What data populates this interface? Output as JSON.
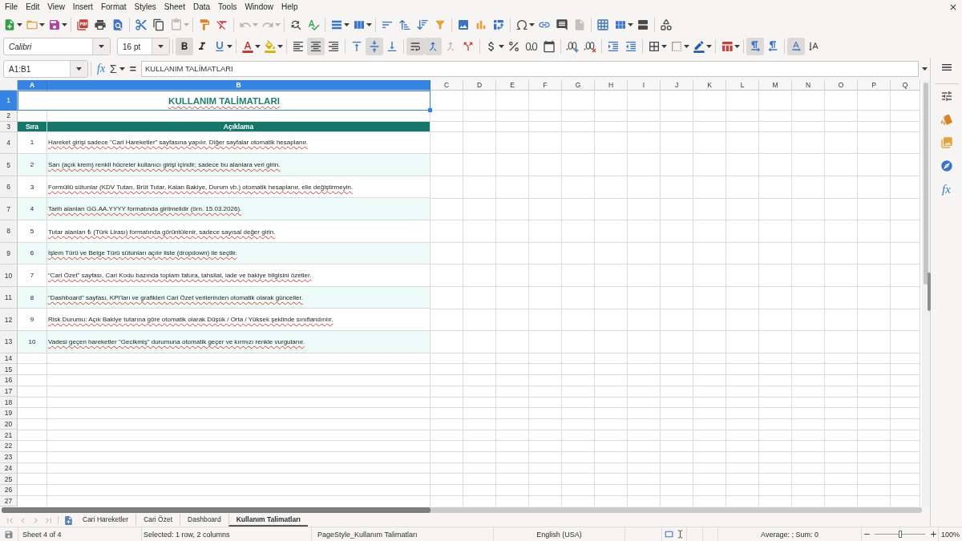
{
  "menu_bar": {
    "items": [
      "File",
      "Edit",
      "View",
      "Insert",
      "Format",
      "Styles",
      "Sheet",
      "Data",
      "Tools",
      "Window",
      "Help"
    ]
  },
  "standard_toolbar": {
    "paste_disabled": true,
    "undo_disabled": true,
    "redo_disabled": true
  },
  "formatting_toolbar": {
    "font_name": "Calibri",
    "font_size": "16 pt",
    "bold": true,
    "italic": false,
    "underline": false,
    "align_left": false,
    "align_center": true,
    "align_right": false,
    "align_top": false,
    "align_middle": true,
    "align_bottom": false,
    "wrap_text": true,
    "merge_and_center": true,
    "merge_cells_disabled": true,
    "left_to_right": true,
    "right_to_left": false,
    "horizontal_text": true,
    "vertical_text": false
  },
  "formula_bar": {
    "name_box": "A1:B1",
    "function_wizard": "fx",
    "sum": "Σ",
    "equals": "=",
    "content": "KULLANIM TALİMATLARI"
  },
  "sheet": {
    "columns": [
      {
        "label": "A",
        "selected": true
      },
      {
        "label": "B",
        "selected": true
      },
      {
        "label": "C",
        "selected": false
      },
      {
        "label": "D",
        "selected": false
      },
      {
        "label": "E",
        "selected": false
      },
      {
        "label": "F",
        "selected": false
      },
      {
        "label": "G",
        "selected": false
      },
      {
        "label": "H",
        "selected": false
      },
      {
        "label": "I",
        "selected": false
      },
      {
        "label": "J",
        "selected": false
      },
      {
        "label": "K",
        "selected": false
      },
      {
        "label": "L",
        "selected": false
      },
      {
        "label": "M",
        "selected": false
      },
      {
        "label": "N",
        "selected": false
      },
      {
        "label": "O",
        "selected": false
      },
      {
        "label": "P",
        "selected": false
      },
      {
        "label": "Q",
        "selected": false
      }
    ],
    "rows": [
      {
        "label": "1",
        "selected": true,
        "kind": "title",
        "text": "KULLANIM TALİMATLARI"
      },
      {
        "label": "2",
        "selected": false,
        "kind": "blank"
      },
      {
        "label": "3",
        "selected": false,
        "kind": "header",
        "cells": [
          "Sıra",
          "Açıklama"
        ]
      },
      {
        "label": "4",
        "selected": false,
        "kind": "entry",
        "cells": [
          "1",
          "Hareket girişi sadece \"Cari Hareketler\" sayfasına yapılır. Diğer sayfalar otomatik hesaplanır."
        ]
      },
      {
        "label": "5",
        "selected": false,
        "kind": "entry",
        "cells": [
          "2",
          "Sarı (açık krem) renkli hücreler kullanıcı girişi içindir; sadece bu alanlara veri girin."
        ]
      },
      {
        "label": "6",
        "selected": false,
        "kind": "entry",
        "cells": [
          "3",
          "Formüllü sütunlar (KDV Tutarı, Brüt Tutar, Kalan Bakiye, Durum vb.) otomatik hesaplanır, elle değiştirmeyin."
        ]
      },
      {
        "label": "7",
        "selected": false,
        "kind": "entry",
        "cells": [
          "4",
          "Tarih alanları GG.AA.YYYY formatında girilmelidir (örn. 15.03.2026)."
        ]
      },
      {
        "label": "8",
        "selected": false,
        "kind": "entry",
        "cells": [
          "5",
          "Tutar alanları ₺ (Türk Lirası) formatında görüntülenir, sadece sayısal değer girin."
        ]
      },
      {
        "label": "9",
        "selected": false,
        "kind": "entry",
        "cells": [
          "6",
          "İşlem Türü ve Belge Türü sütunları açılır liste (dropdown) ile seçilir."
        ]
      },
      {
        "label": "10",
        "selected": false,
        "kind": "entry",
        "cells": [
          "7",
          "\"Cari Özet\" sayfası, Cari Kodu bazında toplam fatura, tahsilat, iade ve bakiye bilgisini özetler."
        ]
      },
      {
        "label": "11",
        "selected": false,
        "kind": "entry",
        "cells": [
          "8",
          "\"Dashboard\" sayfası, KPI'ları ve grafikleri Cari Özet verilerinden otomatik olarak günceller."
        ]
      },
      {
        "label": "12",
        "selected": false,
        "kind": "entry",
        "cells": [
          "9",
          "Risk Durumu: Açık Bakiye tutarına göre otomatik olarak Düşük / Orta / Yüksek şeklinde sınıflandırılır."
        ]
      },
      {
        "label": "13",
        "selected": false,
        "kind": "entry",
        "cells": [
          "10",
          "Vadesi geçen hareketler \"Gecikmiş\" durumuna otomatik geçer ve kırmızı renkle vurgulanır."
        ]
      },
      {
        "label": "14",
        "selected": false,
        "kind": "blank"
      },
      {
        "label": "15",
        "selected": false,
        "kind": "blank"
      },
      {
        "label": "16",
        "selected": false,
        "kind": "blank"
      },
      {
        "label": "17",
        "selected": false,
        "kind": "blank"
      },
      {
        "label": "18",
        "selected": false,
        "kind": "blank"
      },
      {
        "label": "19",
        "selected": false,
        "kind": "blank"
      },
      {
        "label": "20",
        "selected": false,
        "kind": "blank"
      },
      {
        "label": "21",
        "selected": false,
        "kind": "blank"
      },
      {
        "label": "22",
        "selected": false,
        "kind": "blank"
      },
      {
        "label": "23",
        "selected": false,
        "kind": "blank"
      },
      {
        "label": "24",
        "selected": false,
        "kind": "blank"
      },
      {
        "label": "25",
        "selected": false,
        "kind": "blank"
      },
      {
        "label": "26",
        "selected": false,
        "kind": "blank"
      },
      {
        "label": "27",
        "selected": false,
        "kind": "blank"
      }
    ]
  },
  "tab_navigation": {
    "disabled": true
  },
  "sheet_tabs": [
    {
      "label": "Cari Hareketler",
      "selected": false
    },
    {
      "label": "Cari Özet",
      "selected": false
    },
    {
      "label": "Dashboard",
      "selected": false
    },
    {
      "label": "Kullanım Talimatları",
      "selected": true
    }
  ],
  "status_bar": {
    "sheet_position": "Sheet 4 of 4",
    "selection": "Selected: 1 row, 2 columns",
    "page_style": "PageStyle_Kullanım Talimatları",
    "language": "English (USA)",
    "summary": "Average: ; Sum: 0",
    "zoom_slider": {
      "level": 0.5
    },
    "zoom": "100%"
  },
  "sidebar": {
    "functions": "fx"
  }
}
